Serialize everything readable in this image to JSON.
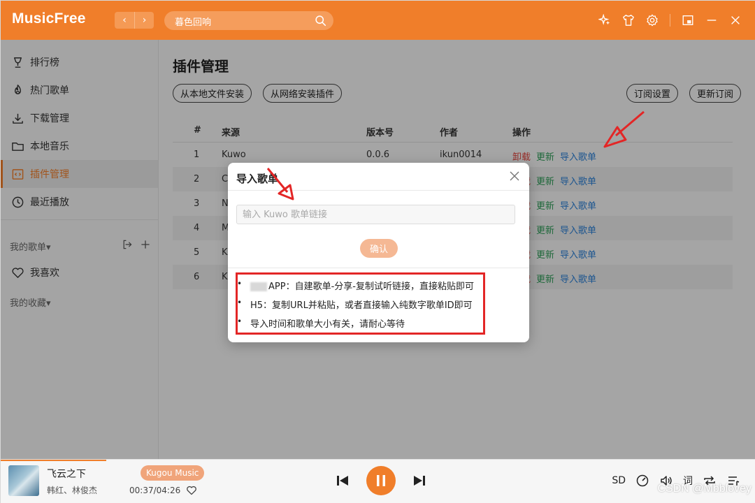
{
  "app": {
    "logo": "MusicFree"
  },
  "nav": {
    "back": "‹",
    "forward": "›"
  },
  "search": {
    "text": "暮色回响"
  },
  "sidebar": {
    "items": [
      {
        "label": "排行榜"
      },
      {
        "label": "热门歌单"
      },
      {
        "label": "下载管理"
      },
      {
        "label": "本地音乐"
      },
      {
        "label": "插件管理"
      },
      {
        "label": "最近播放"
      }
    ],
    "my_playlists": "我的歌单▾",
    "favorite": "我喜欢",
    "my_collections": "我的收藏▾"
  },
  "main": {
    "title": "插件管理",
    "buttons": {
      "install_local": "从本地文件安装",
      "install_network": "从网络安装插件",
      "subscription_settings": "订阅设置",
      "update_subscription": "更新订阅"
    },
    "table": {
      "headers": [
        "#",
        "来源",
        "版本号",
        "作者",
        "操作"
      ],
      "rows": [
        {
          "num": "1",
          "source": "Kuwo",
          "version": "0.0.6",
          "author": "ikun0014"
        },
        {
          "num": "2",
          "source": "C",
          "version": "",
          "author": ""
        },
        {
          "num": "3",
          "source": "N",
          "version": "",
          "author": ""
        },
        {
          "num": "4",
          "source": "M",
          "version": "",
          "author": ""
        },
        {
          "num": "5",
          "source": "K",
          "version": "",
          "author": ""
        },
        {
          "num": "6",
          "source": "K",
          "version": "",
          "author": ""
        }
      ],
      "ops": {
        "uninstall": "卸载",
        "update": "更新",
        "import": "导入歌单"
      }
    }
  },
  "dialog": {
    "title": "导入歌单",
    "input_placeholder": "输入 Kuwo 歌单链接",
    "confirm": "确认",
    "tips": [
      "APP：自建歌单-分享-复制试听链接，直接粘贴即可",
      "H5：复制URL并粘贴，或者直接输入纯数字歌单ID即可",
      "导入时间和歌单大小有关，请耐心等待"
    ]
  },
  "player": {
    "song": "飞云之下",
    "artist": "韩红、林俊杰",
    "source_badge": "Kugou Music",
    "time": "00:37/04:26",
    "quality": "SD",
    "lyric": "词",
    "progress": 0.14
  },
  "watermark": "CSDN @Mbblovey",
  "colors": {
    "accent": "#f07e2a",
    "danger": "#e0443c",
    "success": "#2e9c57",
    "link": "#2b7fd6",
    "annotation": "#e32626"
  }
}
